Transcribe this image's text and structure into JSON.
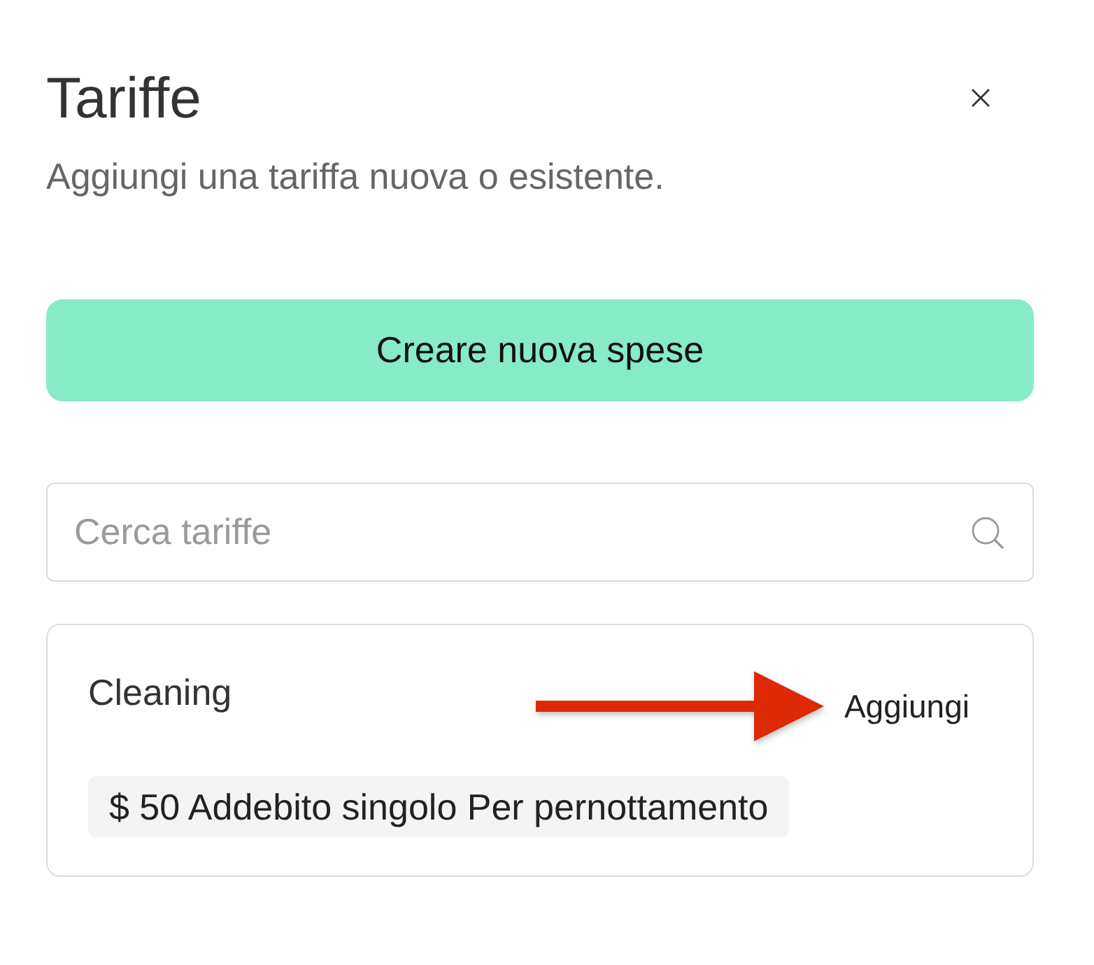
{
  "dialog": {
    "title": "Tariffe",
    "subtitle": "Aggiungi una tariffa nuova o esistente."
  },
  "create_button": {
    "label": "Creare nuova spese"
  },
  "search": {
    "placeholder": "Cerca tariffe"
  },
  "rates": [
    {
      "name": "Cleaning",
      "action": "Aggiungi",
      "details": "$ 50 Addebito singolo Per pernottamento"
    }
  ]
}
